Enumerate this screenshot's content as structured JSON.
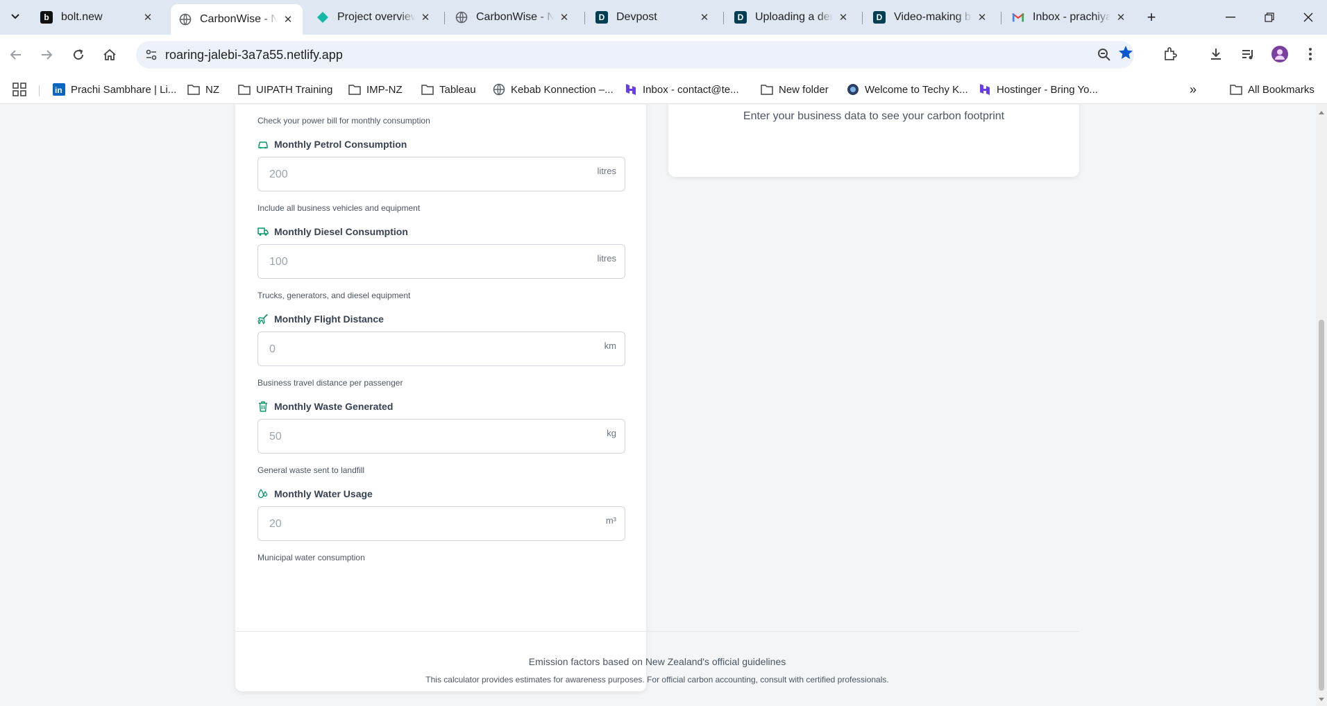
{
  "browser": {
    "tabs": [
      {
        "title": "bolt.new",
        "favicon": "bolt-logo-icon",
        "active": false
      },
      {
        "title": "CarbonWise - NZ",
        "favicon": "globe-icon",
        "active": true
      },
      {
        "title": "Project overview",
        "favicon": "diamond-logo-icon",
        "active": false
      },
      {
        "title": "CarbonWise - NZ",
        "favicon": "globe-icon",
        "active": false
      },
      {
        "title": "Devpost",
        "favicon": "devpost-logo-icon",
        "active": false
      },
      {
        "title": "Uploading a demo",
        "favicon": "devpost-logo-icon",
        "active": false
      },
      {
        "title": "Video-making be",
        "favicon": "devpost-logo-icon",
        "active": false
      },
      {
        "title": "Inbox - prachiya",
        "favicon": "gmail-logo-icon",
        "active": false
      }
    ],
    "url": "roaring-jalebi-3a7a55.netlify.app",
    "bookmarks": [
      {
        "label": "Prachi Sambhare | Li...",
        "icon": "linkedin-icon"
      },
      {
        "label": "NZ",
        "icon": "folder-icon"
      },
      {
        "label": "UIPATH Training",
        "icon": "folder-icon"
      },
      {
        "label": "IMP-NZ",
        "icon": "folder-icon"
      },
      {
        "label": "Tableau",
        "icon": "folder-icon"
      },
      {
        "label": "Kebab Konnection –...",
        "icon": "globe-icon"
      },
      {
        "label": "Inbox - contact@te...",
        "icon": "hostinger-icon"
      },
      {
        "label": "New folder",
        "icon": "folder-icon"
      },
      {
        "label": "Welcome to Techy K...",
        "icon": "site-icon"
      },
      {
        "label": "Hostinger - Bring Yo...",
        "icon": "hostinger-icon"
      }
    ],
    "all_bookmarks_label": "All Bookmarks",
    "colors": {
      "tabstrip": "#dfe7f3",
      "omnibox": "#edf2fa",
      "star": "#0b57d0"
    }
  },
  "form": {
    "top_hint": "Check your power bill for monthly consumption",
    "fields": [
      {
        "label": "Monthly Petrol Consumption",
        "placeholder": "200",
        "unit": "litres",
        "hint": "Include all business vehicles and equipment",
        "icon": "car-icon"
      },
      {
        "label": "Monthly Diesel Consumption",
        "placeholder": "100",
        "unit": "litres",
        "hint": "Trucks, generators, and diesel equipment",
        "icon": "truck-icon"
      },
      {
        "label": "Monthly Flight Distance",
        "placeholder": "0",
        "unit": "km",
        "hint": "Business travel distance per passenger",
        "icon": "plane-icon"
      },
      {
        "label": "Monthly Waste Generated",
        "placeholder": "50",
        "unit": "kg",
        "hint": "General waste sent to landfill",
        "icon": "trash-icon"
      },
      {
        "label": "Monthly Water Usage",
        "placeholder": "20",
        "unit": "m³",
        "hint": "Municipal water consumption",
        "icon": "droplets-icon"
      }
    ],
    "accent_color": "#059669"
  },
  "result": {
    "message": "Enter your business data to see your carbon footprint"
  },
  "footer": {
    "line1": "Emission factors based on New Zealand's official guidelines",
    "line2": "This calculator provides estimates for awareness purposes. For official carbon accounting, consult with certified professionals."
  }
}
